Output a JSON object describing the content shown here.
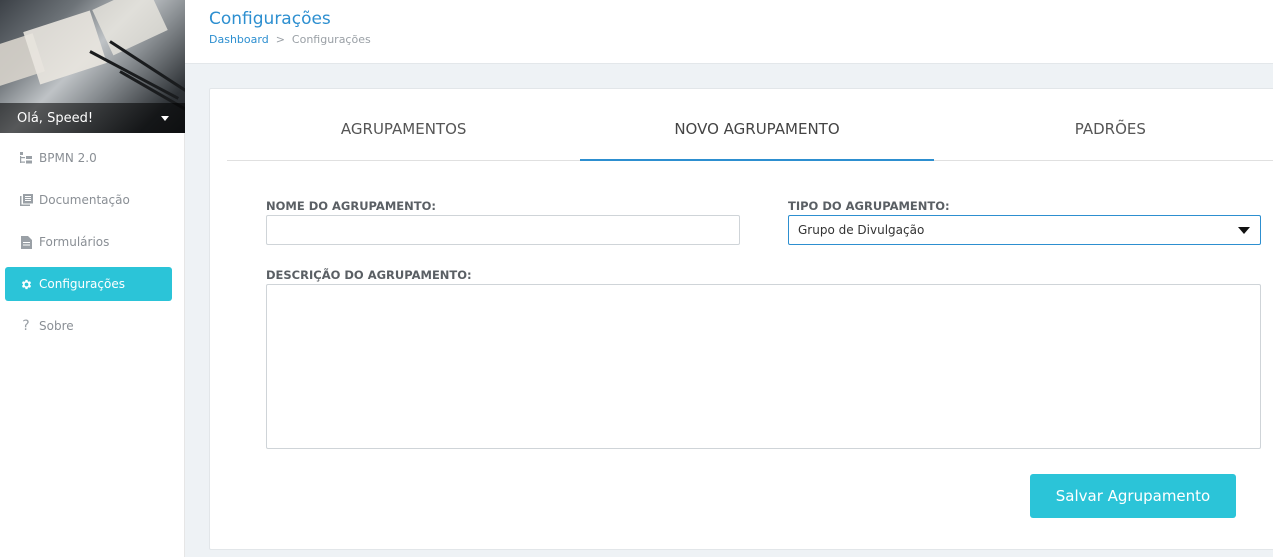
{
  "sidebar": {
    "greeting": "Olá, Speed!",
    "items": [
      {
        "label": "BPMN 2.0",
        "icon": "sitemap-icon"
      },
      {
        "label": "Documentação",
        "icon": "book-icon"
      },
      {
        "label": "Formulários",
        "icon": "file-icon"
      },
      {
        "label": "Configurações",
        "icon": "gear-icon",
        "active": true
      },
      {
        "label": "Sobre",
        "icon": "question-icon"
      }
    ]
  },
  "header": {
    "title": "Configurações",
    "breadcrumb": {
      "home": "Dashboard",
      "separator": ">",
      "current": "Configurações"
    }
  },
  "tabs": [
    {
      "label": "AGRUPAMENTOS",
      "active": false
    },
    {
      "label": "NOVO AGRUPAMENTO",
      "active": true
    },
    {
      "label": "PADRÕES",
      "active": false
    }
  ],
  "form": {
    "name_label": "NOME DO AGRUPAMENTO:",
    "name_value": "",
    "type_label": "TIPO DO AGRUPAMENTO:",
    "type_value": "Grupo de Divulgação",
    "description_label": "DESCRIÇÃO DO AGRUPAMENTO:",
    "description_value": "",
    "save_label": "Salvar Agrupamento"
  },
  "colors": {
    "accent": "#2bc4d8",
    "link": "#2d8fd0"
  }
}
